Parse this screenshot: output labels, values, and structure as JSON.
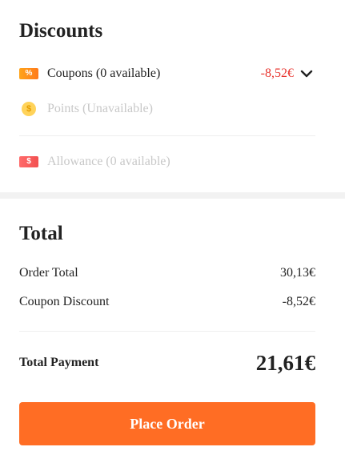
{
  "discounts": {
    "title": "Discounts",
    "coupons": {
      "icon": "coupon-tag-icon",
      "icon_glyph": "%",
      "label": "Coupons (0 available)",
      "value": "-8,52€",
      "chevron": "chevron-down-icon"
    },
    "points": {
      "icon": "points-coin-icon",
      "icon_glyph": "$",
      "label": "Points (Unavailable)"
    },
    "allowance": {
      "icon": "allowance-tag-icon",
      "icon_glyph": "$",
      "label": "Allowance (0 available)"
    }
  },
  "total": {
    "title": "Total",
    "order_total_label": "Order Total",
    "order_total_value": "30,13€",
    "coupon_discount_label": "Coupon Discount",
    "coupon_discount_value": "-8,52€",
    "total_payment_label": "Total Payment",
    "total_payment_value": "21,61€"
  },
  "actions": {
    "place_order_label": "Place Order"
  },
  "colors": {
    "accent": "#ff6d24",
    "discount_red": "#e8352f",
    "muted_text": "#c8c8c8",
    "coin_yellow": "#ffd35a"
  }
}
